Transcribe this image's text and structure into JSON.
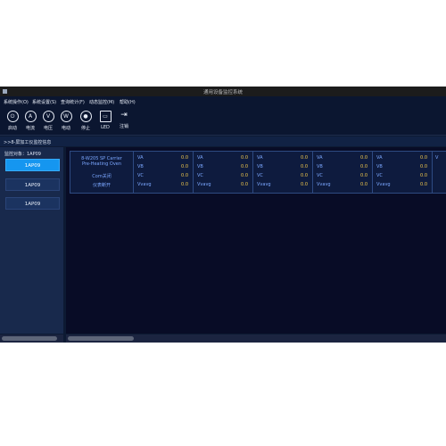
{
  "window": {
    "title": "通用设备监控系统"
  },
  "menu": [
    "系统操作(O)",
    "系统设置(S)",
    "查询统计(F)",
    "动态监控(M)",
    "帮助(H)"
  ],
  "toolbar": [
    {
      "label": "启动",
      "icon": "power-icon",
      "glyph": "⏻"
    },
    {
      "label": "电流",
      "icon": "ammeter-icon",
      "glyph": "A"
    },
    {
      "label": "电压",
      "icon": "voltmeter-icon",
      "glyph": "V"
    },
    {
      "label": "电动",
      "icon": "wattmeter-icon",
      "glyph": "W"
    },
    {
      "label": "停止",
      "icon": "stop-icon",
      "glyph": "●"
    },
    {
      "label": "LED",
      "icon": "monitor-icon",
      "glyph": "▭"
    },
    {
      "label": "注销",
      "icon": "logout-icon",
      "glyph": "⇥"
    }
  ],
  "breadcrumb": ">>8-屏加工仪监控信息",
  "sidebar": {
    "title": "监控对象：1AP09",
    "items": [
      "1AP09",
      "1AP09",
      "1AP09"
    ]
  },
  "device": {
    "title_line1": "8-W205 SP Carrier",
    "title_line2": "Pre-Heating Oven",
    "com_status": "Com关闭",
    "device_status": "仪表断开"
  },
  "metrics": [
    {
      "labels": [
        "VA",
        "VB",
        "VC",
        "Vvavg"
      ],
      "values": [
        "0.0",
        "0.0",
        "0.0",
        "0.0"
      ]
    },
    {
      "labels": [
        "VA",
        "VB",
        "VC",
        "Vvavg"
      ],
      "values": [
        "0.0",
        "0.0",
        "0.0",
        "0.0"
      ]
    },
    {
      "labels": [
        "VA",
        "VB",
        "VC",
        "Vvavg"
      ],
      "values": [
        "0.0",
        "0.0",
        "0.0",
        "0.0"
      ]
    },
    {
      "labels": [
        "VA",
        "VB",
        "VC",
        "Vvavg"
      ],
      "values": [
        "0.0",
        "0.0",
        "0.0",
        "0.0"
      ]
    },
    {
      "labels": [
        "VA",
        "VB",
        "VC",
        "Vvavg"
      ],
      "values": [
        "0.0",
        "0.0",
        "0.0",
        "0.0"
      ]
    },
    {
      "labels": [
        "V"
      ]
    }
  ],
  "colors": {
    "accent": "#1596f0",
    "value": "#f2c94c",
    "label": "#7ba7ff",
    "background": "#080c26"
  }
}
